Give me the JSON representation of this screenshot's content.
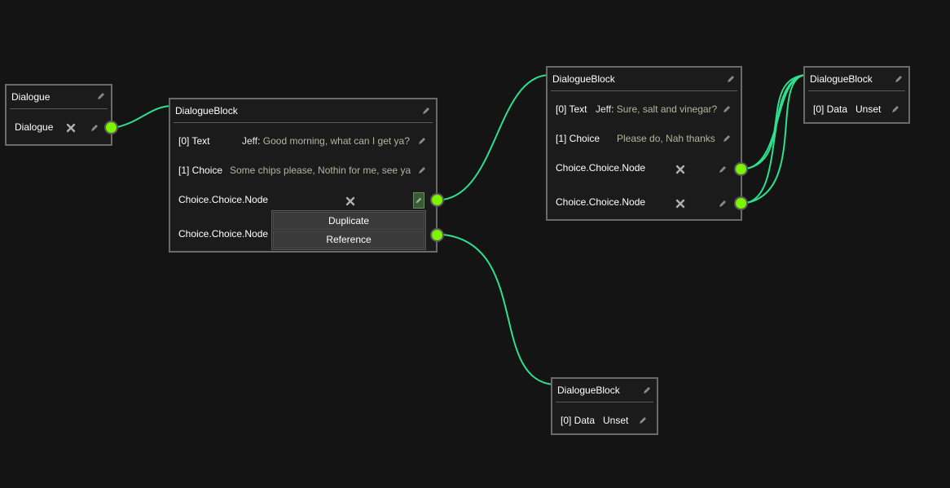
{
  "colors": {
    "background": "#141414",
    "wire": "#2ee08e",
    "port": "#7cf400",
    "node_border": "#6a6a6a"
  },
  "nodes": {
    "dialogue": {
      "title": "Dialogue",
      "row_label": "Dialogue"
    },
    "block_main": {
      "title": "DialogueBlock",
      "rows": [
        {
          "label": "[0] Text",
          "speaker": "Jeff:",
          "value": " Good morning, what can I get ya?"
        },
        {
          "label": "[1] Choice",
          "value": "Some chips please, Nothin for me, see ya"
        },
        {
          "label": "Choice.Choice.Node"
        },
        {
          "label": "Choice.Choice.Node"
        }
      ]
    },
    "block_top": {
      "title": "DialogueBlock",
      "rows": [
        {
          "label": "[0] Text",
          "speaker": "Jeff:",
          "value": " Sure, salt and vinegar?"
        },
        {
          "label": "[1] Choice",
          "value": "Please do, Nah thanks"
        },
        {
          "label": "Choice.Choice.Node"
        },
        {
          "label": "Choice.Choice.Node"
        }
      ]
    },
    "block_far": {
      "title": "DialogueBlock",
      "row_label": "[0] Data",
      "row_value": "Unset"
    },
    "block_bottom": {
      "title": "DialogueBlock",
      "row_label": "[0] Data",
      "row_value": "Unset"
    }
  },
  "context_menu": {
    "items": [
      "Duplicate",
      "Reference"
    ]
  },
  "icons": {
    "edit": "pencil-icon",
    "remove": "close-icon",
    "port": "output-port-icon"
  }
}
